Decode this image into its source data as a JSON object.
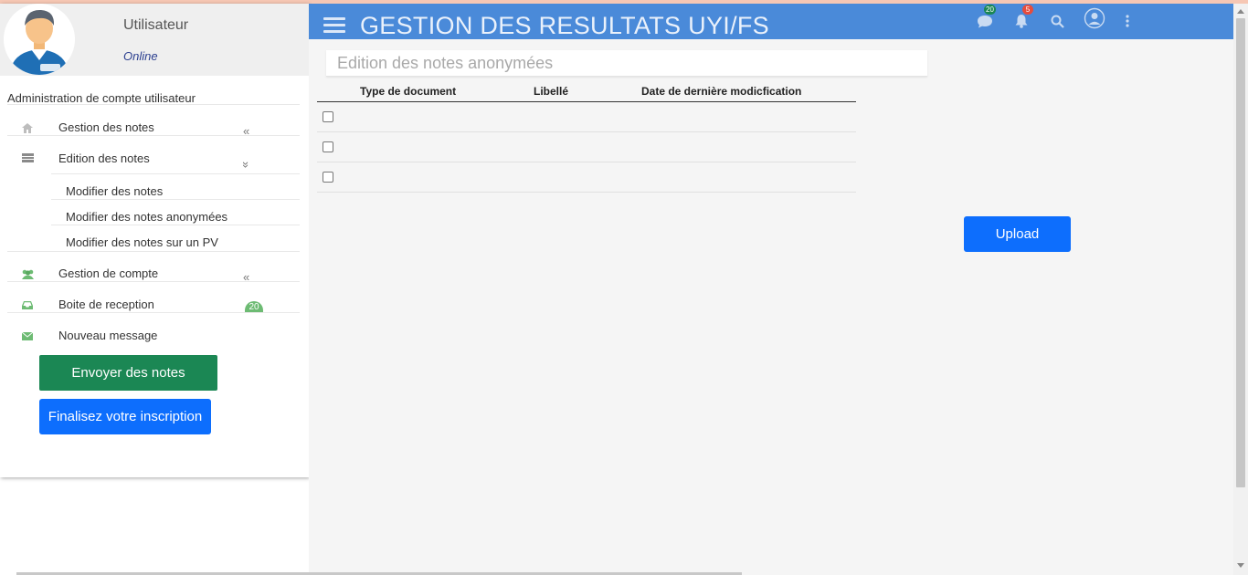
{
  "profile": {
    "name": "Utilisateur",
    "status": "Online"
  },
  "sidebar": {
    "section_title": "Administration de compte utilisateur",
    "items": [
      {
        "label": "Gestion des notes",
        "icon": "home-icon",
        "chevron": "«"
      },
      {
        "label": "Edition des notes",
        "icon": "list-icon",
        "chevron": "»"
      },
      {
        "label": "Gestion de compte",
        "icon": "users-icon",
        "chevron": "«"
      },
      {
        "label": "Boite de reception",
        "icon": "inbox-icon",
        "badge": "20"
      },
      {
        "label": "Nouveau message",
        "icon": "envelope-icon"
      }
    ],
    "subitems": [
      {
        "label": "Modifier des notes"
      },
      {
        "label": "Modifier des notes anonymées"
      },
      {
        "label": "Modifier des notes sur un PV"
      }
    ],
    "send_button": "Envoyer des notes",
    "finalize_button": "Finalisez votre inscription"
  },
  "header": {
    "title": "GESTION DES RESULTATS UYI/FS",
    "messages_badge": "20",
    "notifications_badge": "5",
    "icons": [
      "menu-icon",
      "chat-icon",
      "bell-icon",
      "search-icon",
      "user-icon",
      "more-vertical-icon"
    ]
  },
  "main": {
    "search_placeholder": "Edition des notes anonymées",
    "table": {
      "headers": [
        "Type de document",
        "Libellé",
        "Date de dernière modicfication"
      ],
      "rows": [
        {},
        {},
        {}
      ]
    },
    "upload_button": "Upload"
  },
  "colors": {
    "header": "#4a8ad9",
    "primary": "#0d6efd",
    "success": "#1b8754",
    "badge_green": "#6dbb73",
    "badge_red": "#e74c3c"
  }
}
